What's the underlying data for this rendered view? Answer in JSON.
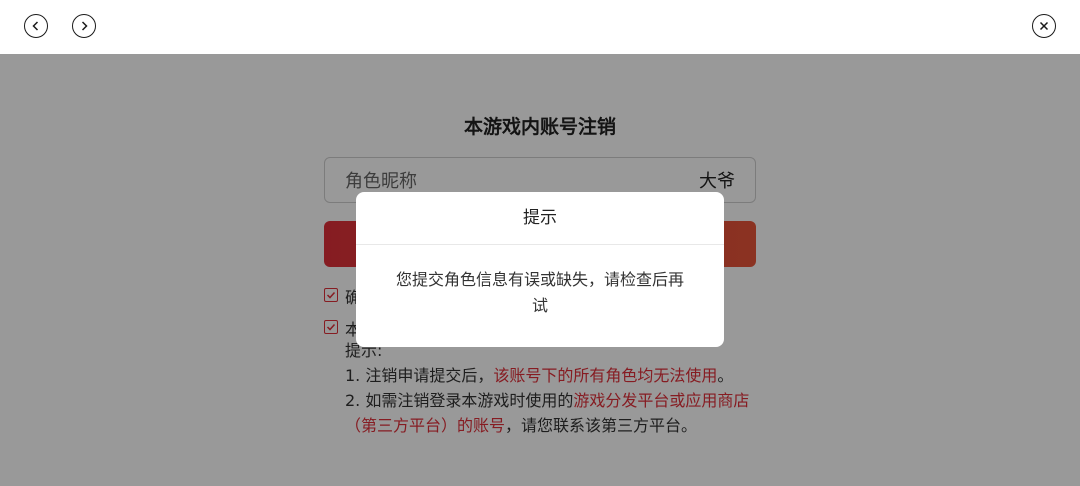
{
  "nav": {
    "back_icon": "chevron-left-icon",
    "forward_icon": "chevron-right-icon",
    "close_icon": "close-icon"
  },
  "page": {
    "title": "本游戏内账号注销",
    "nickname_label": "角色昵称",
    "nickname_value": "大爷",
    "confirm_prefix": "确",
    "agree_prefix": "本",
    "notice_title": "提示:",
    "notice_1_prefix": "1. 注销申请提交后，",
    "notice_1_red": "该账号下的所有角色均无法使用",
    "notice_1_suffix": "。",
    "notice_2_prefix": "2. 如需注销登录本游戏时使用的",
    "notice_2_red": "游戏分发平台或应用商店（第三方平台）的账号",
    "notice_2_suffix": "，请您联系该第三方平台。"
  },
  "dialog": {
    "title": "提示",
    "message": "您提交角色信息有误或缺失，请检查后再试"
  },
  "colors": {
    "accent": "#e0303a",
    "overlay": "rgba(0,0,0,0.4)"
  }
}
